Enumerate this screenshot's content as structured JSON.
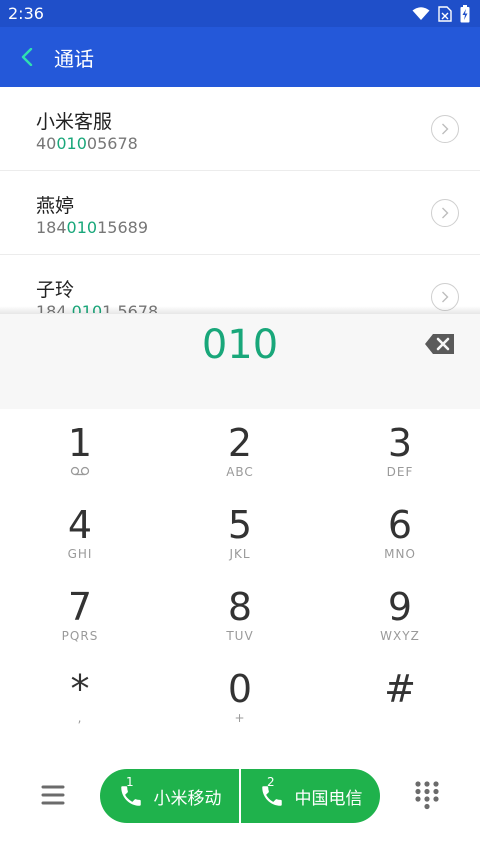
{
  "status": {
    "time": "2:36"
  },
  "appbar": {
    "title": "通话"
  },
  "contacts": [
    {
      "name": "小米客服",
      "num_pre": "40",
      "num_hl": "010",
      "num_post": "05678"
    },
    {
      "name": "燕婷",
      "num_pre": "184",
      "num_hl": "010",
      "num_post": "15689"
    },
    {
      "name": "子玲",
      "num_pre": "184 ",
      "num_hl": "010",
      "num_post": "1 5678"
    }
  ],
  "dialer": {
    "entry": "010"
  },
  "keys": [
    {
      "digit": "1",
      "letters": ""
    },
    {
      "digit": "2",
      "letters": "ABC"
    },
    {
      "digit": "3",
      "letters": "DEF"
    },
    {
      "digit": "4",
      "letters": "GHI"
    },
    {
      "digit": "5",
      "letters": "JKL"
    },
    {
      "digit": "6",
      "letters": "MNO"
    },
    {
      "digit": "7",
      "letters": "PQRS"
    },
    {
      "digit": "8",
      "letters": "TUV"
    },
    {
      "digit": "9",
      "letters": "WXYZ"
    },
    {
      "digit": "*",
      "letters": ","
    },
    {
      "digit": "0",
      "letters": "+"
    },
    {
      "digit": "#",
      "letters": ""
    }
  ],
  "call": [
    {
      "sim": "1",
      "label": "小米移动"
    },
    {
      "sim": "2",
      "label": "中国电信"
    }
  ],
  "colors": {
    "statusbar": "#1f4fc9",
    "appbar": "#2458d9",
    "accent": "#19a77a",
    "call": "#1fb24c"
  }
}
